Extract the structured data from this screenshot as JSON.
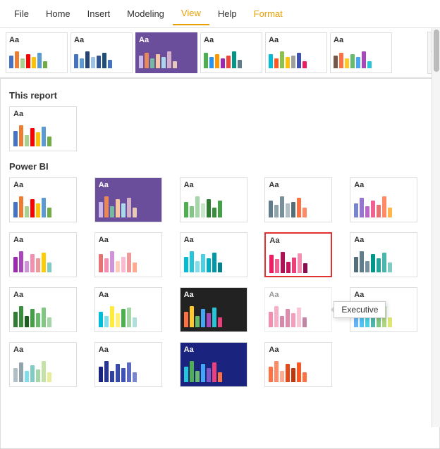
{
  "menubar": {
    "items": [
      {
        "label": "File",
        "active": false
      },
      {
        "label": "Home",
        "active": false
      },
      {
        "label": "Insert",
        "active": false
      },
      {
        "label": "Modeling",
        "active": false
      },
      {
        "label": "View",
        "active": true
      },
      {
        "label": "Help",
        "active": false
      },
      {
        "label": "Format",
        "active": false,
        "format": true
      }
    ]
  },
  "sections": {
    "this_report_label": "This report",
    "power_bi_label": "Power BI"
  },
  "tooltip": {
    "label": "Executive"
  },
  "ribbon_scroll": "▾"
}
